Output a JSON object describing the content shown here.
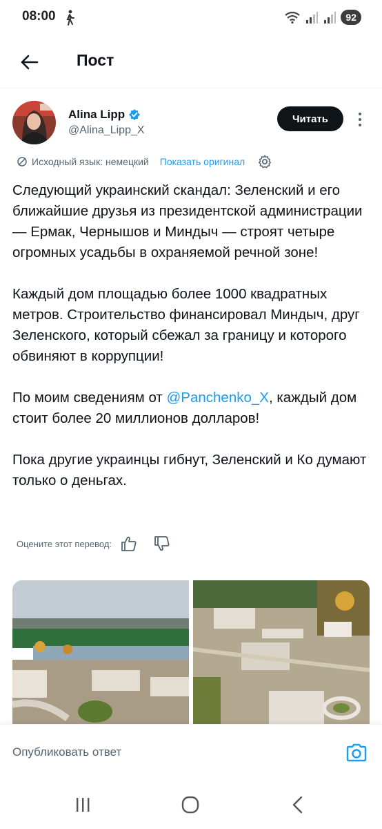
{
  "status": {
    "time": "08:00",
    "battery": "92"
  },
  "header": {
    "title": "Пост",
    "back_icon": "arrow-left-icon"
  },
  "author": {
    "name": "Alina Lipp",
    "handle": "@Alina_Lipp_X",
    "verified": true,
    "follow_label": "Читать"
  },
  "translation": {
    "source_label": "Исходный язык: немецкий",
    "show_original": "Показать оригинал"
  },
  "post": {
    "p1": "Следующий украинский скандал: Зеленский и его ближайшие друзья из президентской администрации — Ермак, Чернышов и Миндыч — строят четыре огромных усадьбы в охраняемой речной зоне!",
    "p2": "Каждый дом площадью более 1000 квадратных метров. Строительство финансировал Миндыч, друг Зеленского, который сбежал за границу и которого обвиняют в коррупции!",
    "p3_before": "По моим сведениям от ",
    "p3_mention": "@Panchenko_X",
    "p3_after": ", каждый дом стоит более 20 миллионов долларов!",
    "p4": "Пока другие украинцы гибнут, Зеленский и Ко думают только о деньгах."
  },
  "rating": {
    "label": "Оцените этот перевод:"
  },
  "reply": {
    "placeholder": "Опубликовать ответ"
  },
  "colors": {
    "accent": "#1d9bf0",
    "text": "#0f1419",
    "secondary": "#536471"
  }
}
